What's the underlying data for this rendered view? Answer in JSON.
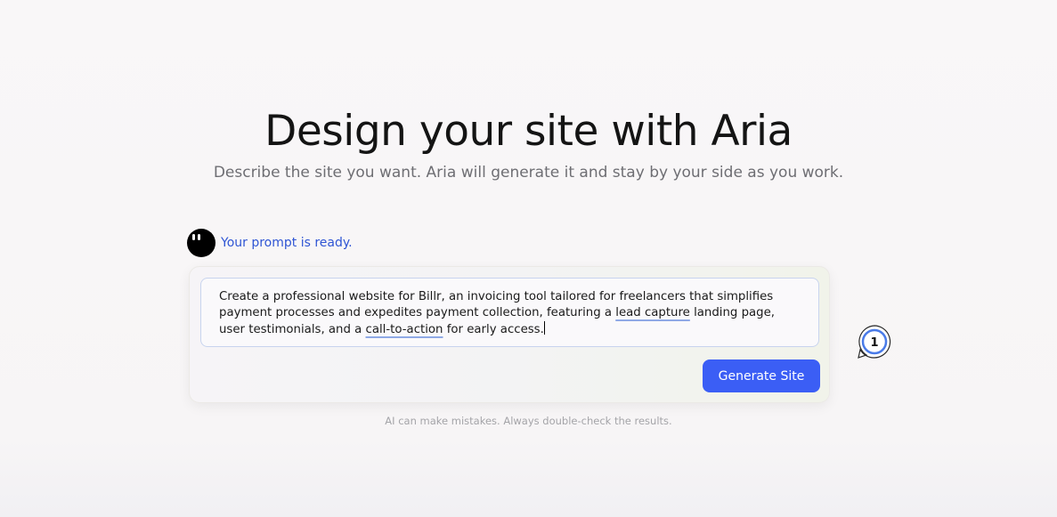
{
  "hero": {
    "title": "Design your site with Aria",
    "subtitle": "Describe the site you want. Aria will generate it and stay by your side as you work."
  },
  "assistant": {
    "status": "Your prompt is ready."
  },
  "prompt": {
    "part1": "Create a professional website for Billr, an invoicing tool tailored for freelancers that simplifies payment processes and expedites payment collection, featuring a ",
    "highlight1": "lead capture",
    "part2": " landing page, user testimonials, and a ",
    "highlight2": "call-to-action",
    "part3": " for early access."
  },
  "actions": {
    "generate_label": "Generate Site"
  },
  "disclaimer": "AI can make mistakes. Always double-check the results.",
  "badge": {
    "count": "1"
  },
  "colors": {
    "accent": "#3b5ef5",
    "status_text": "#2f55d4",
    "highlight_underline": "#8fa9e6"
  }
}
